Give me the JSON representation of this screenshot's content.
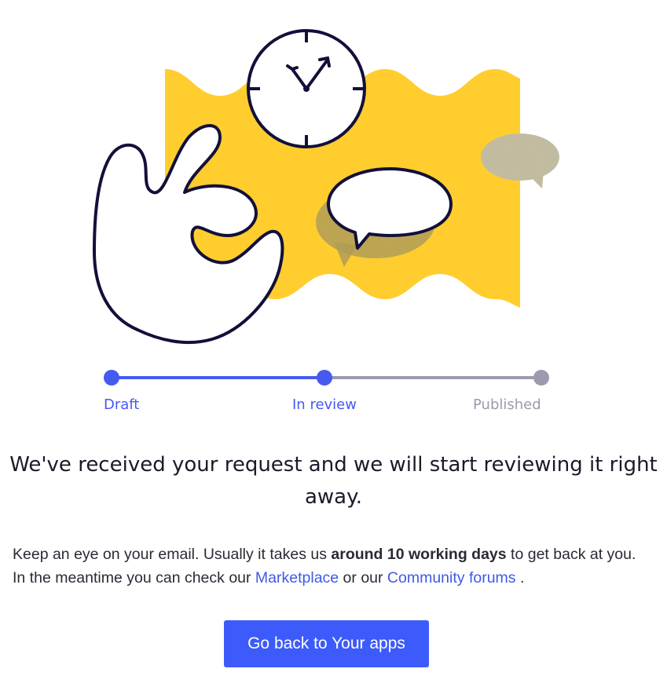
{
  "illustration": {
    "icons": [
      "clock-icon",
      "hand-ok-icon",
      "speech-bubble-icon",
      "yellow-banner"
    ],
    "colors": {
      "banner": "#ffcd2e",
      "outline": "#12103a",
      "shadow": "#b9a356",
      "ghost_bubble": "#c9c3a7"
    }
  },
  "progress": {
    "current_step": 2,
    "steps": [
      {
        "label": "Draft",
        "status": "done"
      },
      {
        "label": "In review",
        "status": "current"
      },
      {
        "label": "Published",
        "status": "pending"
      }
    ],
    "colors": {
      "active": "#4659f0",
      "inactive": "#9d9aad"
    }
  },
  "headline": "We've received your request and we will start reviewing it right away.",
  "body": {
    "part1": "Keep an eye on your email. Usually it takes us ",
    "emphasis": "around 10 working days",
    "part2": " to get back at you. In the meantime you can check our ",
    "link_marketplace": "Marketplace",
    "part3": " or our ",
    "link_forums": "Community forums",
    "part4": " ."
  },
  "cta": {
    "label": "Go back to Your apps",
    "color": "#3d5bfa"
  }
}
